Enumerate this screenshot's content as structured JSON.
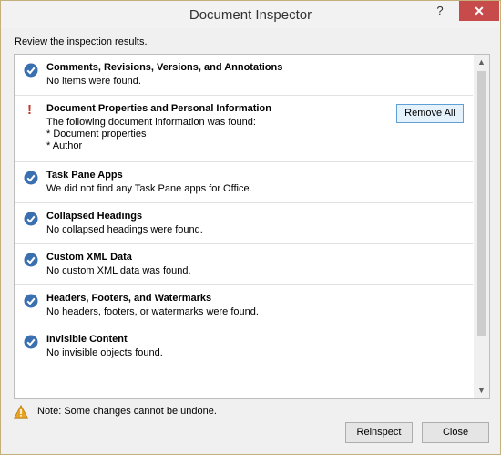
{
  "window": {
    "title": "Document Inspector",
    "help": "?",
    "close_icon": "✕"
  },
  "prompt": "Review the inspection results.",
  "items": [
    {
      "status": "ok",
      "name": "Comments, Revisions, Versions, and Annotations",
      "desc": "No items were found."
    },
    {
      "status": "warning",
      "name": "Document Properties and Personal Information",
      "desc": "The following document information was found:",
      "details": [
        "* Document properties",
        "* Author"
      ],
      "action": "Remove All"
    },
    {
      "status": "ok",
      "name": "Task Pane Apps",
      "desc": "We did not find any Task Pane apps for Office."
    },
    {
      "status": "ok",
      "name": "Collapsed Headings",
      "desc": "No collapsed headings were found."
    },
    {
      "status": "ok",
      "name": "Custom XML Data",
      "desc": "No custom XML data was found."
    },
    {
      "status": "ok",
      "name": "Headers, Footers, and Watermarks",
      "desc": "No headers, footers, or watermarks were found."
    },
    {
      "status": "ok",
      "name": "Invisible Content",
      "desc": "No invisible objects found."
    }
  ],
  "note": "Note: Some changes cannot be undone.",
  "buttons": {
    "reinspect": "Reinspect",
    "close": "Close"
  },
  "colors": {
    "ok": "#3a6fb0",
    "warning": "#c0392b",
    "close_button": "#c74b4b"
  }
}
